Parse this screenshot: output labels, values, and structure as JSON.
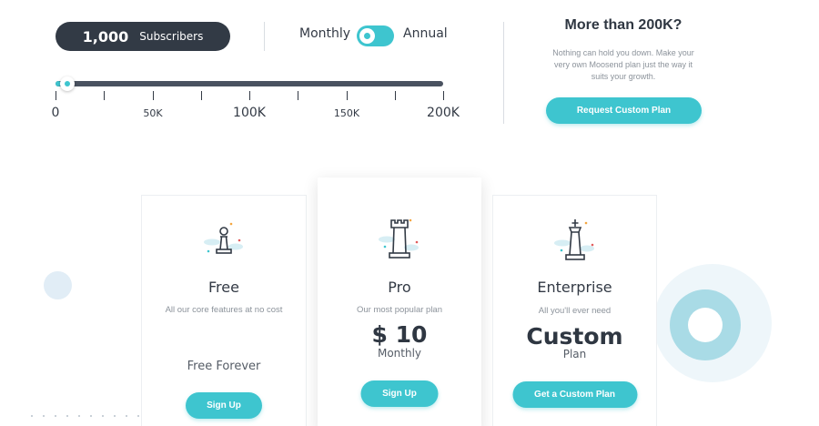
{
  "subscribers": {
    "count": "1,000",
    "label": "Subscribers"
  },
  "billing": {
    "monthly_label": "Monthly",
    "annual_label": "Annual",
    "toggle_state": "monthly"
  },
  "slider": {
    "value": 1000,
    "min": 0,
    "max": 200000,
    "labels": [
      {
        "text": "0",
        "value": 0,
        "size": "big"
      },
      {
        "text": "50K",
        "value": 50000,
        "size": "small"
      },
      {
        "text": "100K",
        "value": 100000,
        "size": "big"
      },
      {
        "text": "150K",
        "value": 150000,
        "size": "small"
      },
      {
        "text": "200K",
        "value": 200000,
        "size": "big"
      }
    ],
    "tick_values": [
      0,
      25000,
      50000,
      75000,
      100000,
      125000,
      150000,
      175000,
      200000
    ]
  },
  "custom": {
    "title": "More than 200K?",
    "description": "Nothing can hold you down. Make your very own Moosend plan just the way it suits your growth.",
    "button": "Request Custom Plan"
  },
  "plans": {
    "free": {
      "name": "Free",
      "description": "All our core features at no cost",
      "price_text": "Free Forever",
      "button": "Sign Up",
      "icon": "pawn-icon"
    },
    "pro": {
      "name": "Pro",
      "description": "Our most popular plan",
      "price": "$ 10",
      "price_sub": "Monthly",
      "button": "Sign Up",
      "icon": "rook-icon"
    },
    "enterprise": {
      "name": "Enterprise",
      "description": "All you'll ever need",
      "price": "Custom",
      "price_sub": "Plan",
      "button": "Get a Custom Plan",
      "icon": "king-icon"
    }
  },
  "colors": {
    "accent": "#3ec5cf",
    "dark": "#323a45",
    "muted": "#8c939b"
  }
}
